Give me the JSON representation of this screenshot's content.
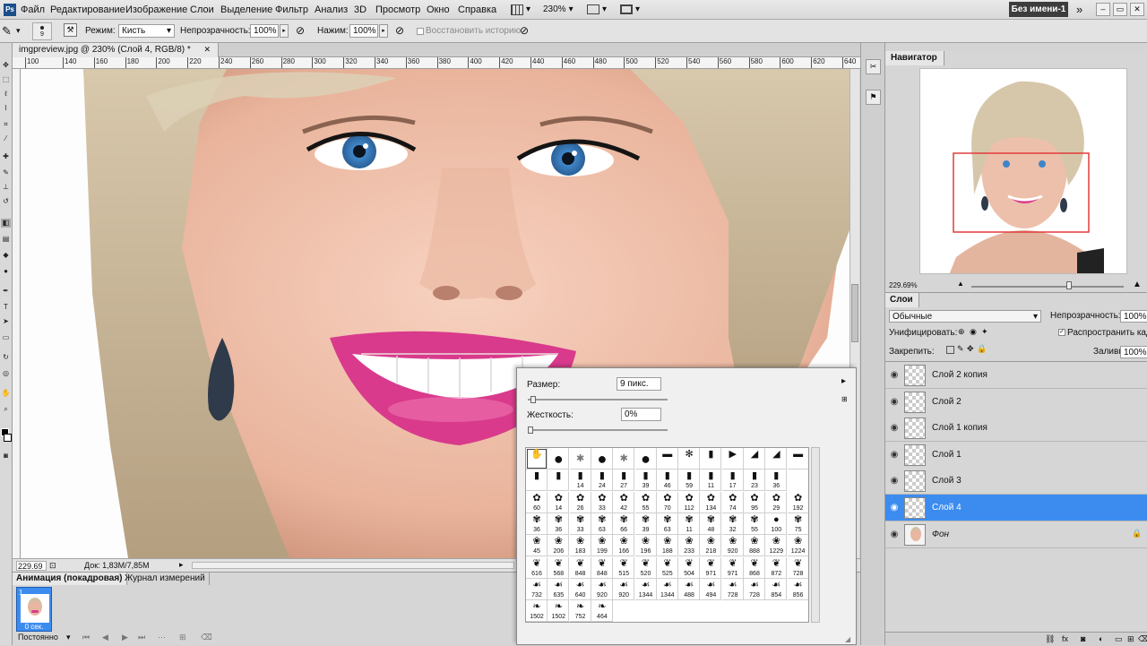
{
  "menubar": {
    "items": [
      "Файл",
      "Редактирование",
      "Изображение",
      "Слои",
      "Выделение",
      "Фильтр",
      "Анализ",
      "3D",
      "Просмотр",
      "Окно",
      "Справка"
    ],
    "zoom": "230%",
    "document_name": "Без имени-1",
    "more": "»",
    "win_minimize": "–",
    "win_restore": "▭",
    "win_close": "✕"
  },
  "options": {
    "mode_label": "Режим:",
    "mode_value": "Кисть",
    "opacity_label": "Непрозрачность:",
    "opacity_value": "100%",
    "pressure_label": "Нажим:",
    "pressure_value": "100%",
    "restore_history_label": "Восстановить историю",
    "brush_size_small": "9"
  },
  "document": {
    "tab_title": "imgpreview.jpg @ 230% (Слой 4, RGB/8) *",
    "ruler_ticks": [
      "100",
      "140",
      "160",
      "180",
      "200",
      "220",
      "240",
      "260",
      "280",
      "300",
      "320",
      "340",
      "360",
      "380",
      "400",
      "420",
      "440",
      "460",
      "480",
      "500",
      "520",
      "540",
      "560",
      "580",
      "600",
      "620",
      "640"
    ],
    "zoom_status": "229.69",
    "doc_status": "Док: 1,83M/7,85M"
  },
  "animation": {
    "tab_animation": "Анимация (покадровая)",
    "tab_measure": "Журнал измерений",
    "frame_number": "1",
    "frame_time": "0 сек.",
    "loop_option": "Постоянно"
  },
  "navigator": {
    "title": "Навигатор",
    "zoom": "229.69%"
  },
  "layers": {
    "title": "Слои",
    "blend_mode": "Обычные",
    "opacity_label": "Непрозрачность:",
    "opacity_value": "100%",
    "unify_label": "Унифицировать:",
    "propagate_label": "Распространить кадр",
    "lock_label": "Закрепить:",
    "fill_label": "Заливка:",
    "fill_value": "100%",
    "items": [
      {
        "name": "Слой 2 копия",
        "selected": false,
        "italic": false
      },
      {
        "name": "Слой 2",
        "selected": false,
        "italic": false
      },
      {
        "name": "Слой 1 копия",
        "selected": false,
        "italic": false
      },
      {
        "name": "Слой 1",
        "selected": false,
        "italic": false
      },
      {
        "name": "Слой 3",
        "selected": false,
        "italic": false
      },
      {
        "name": "Слой 4",
        "selected": true,
        "italic": false
      },
      {
        "name": "Фон",
        "selected": false,
        "italic": true
      }
    ]
  },
  "brush_picker": {
    "size_label": "Размер:",
    "size_value": "9 пикс.",
    "hardness_label": "Жесткость:",
    "hardness_value": "0%",
    "rows": [
      [
        "",
        "",
        "",
        "",
        "",
        "",
        "",
        "",
        "",
        "",
        "",
        "",
        ""
      ],
      [
        "",
        "",
        "14",
        "24",
        "27",
        "39",
        "46",
        "59",
        "11",
        "17",
        "23",
        "36"
      ],
      [
        "60",
        "14",
        "26",
        "33",
        "42",
        "55",
        "70",
        "112",
        "134",
        "74",
        "95",
        "29",
        "192"
      ],
      [
        "36",
        "36",
        "33",
        "63",
        "66",
        "39",
        "63",
        "11",
        "48",
        "32",
        "55",
        "100",
        "75"
      ],
      [
        "45",
        "206",
        "183",
        "199",
        "166",
        "196",
        "188",
        "233",
        "218",
        "920",
        "888",
        "1229",
        "1224"
      ],
      [
        "616",
        "568",
        "848",
        "848",
        "515",
        "520",
        "525",
        "504",
        "971",
        "971",
        "868",
        "872",
        "728"
      ],
      [
        "732",
        "635",
        "640",
        "920",
        "920",
        "1344",
        "1344",
        "488",
        "494",
        "728",
        "728",
        "854",
        "856"
      ],
      [
        "1502",
        "1502",
        "752",
        "464"
      ]
    ]
  },
  "colors": {
    "selection_blue": "#3c8cf0",
    "lip_pink": "#d93a8c",
    "iris_blue": "#3f86c9"
  }
}
